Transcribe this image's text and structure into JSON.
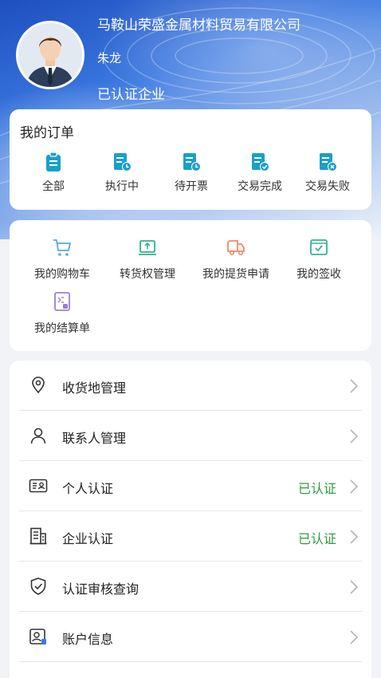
{
  "profile": {
    "company": "马鞍山荣盛金属材料贸易有限公司",
    "username": "朱龙",
    "status": "已认证企业"
  },
  "orders": {
    "title": "我的订单",
    "items": [
      {
        "label": "全部",
        "icon": "clipboard-icon"
      },
      {
        "label": "执行中",
        "icon": "doc-clock-icon"
      },
      {
        "label": "待开票",
        "icon": "doc-clock-icon"
      },
      {
        "label": "交易完成",
        "icon": "doc-check-icon"
      },
      {
        "label": "交易失败",
        "icon": "doc-x-icon"
      }
    ],
    "accent": "#1aa0c8"
  },
  "tools": {
    "items": [
      {
        "label": "我的购物车",
        "icon": "cart-icon",
        "color": "#5aa7e6"
      },
      {
        "label": "转货权管理",
        "icon": "transfer-icon",
        "color": "#2fb38a"
      },
      {
        "label": "我的提货申请",
        "icon": "truck-icon",
        "color": "#f08a6a"
      },
      {
        "label": "我的签收",
        "icon": "inbox-check-icon",
        "color": "#34b29a"
      },
      {
        "label": "我的结算单",
        "icon": "settlement-icon",
        "color": "#9b7fd9"
      }
    ]
  },
  "menu": {
    "items": [
      {
        "label": "收货地管理",
        "icon": "location-icon",
        "status": ""
      },
      {
        "label": "联系人管理",
        "icon": "person-icon",
        "status": ""
      },
      {
        "label": "个人认证",
        "icon": "id-card-icon",
        "status": "已认证"
      },
      {
        "label": "企业认证",
        "icon": "building-icon",
        "status": "已认证"
      },
      {
        "label": "认证审核查询",
        "icon": "shield-check-icon",
        "status": ""
      },
      {
        "label": "账户信息",
        "icon": "account-icon",
        "status": ""
      }
    ],
    "status_color": "#2e9b3e"
  }
}
